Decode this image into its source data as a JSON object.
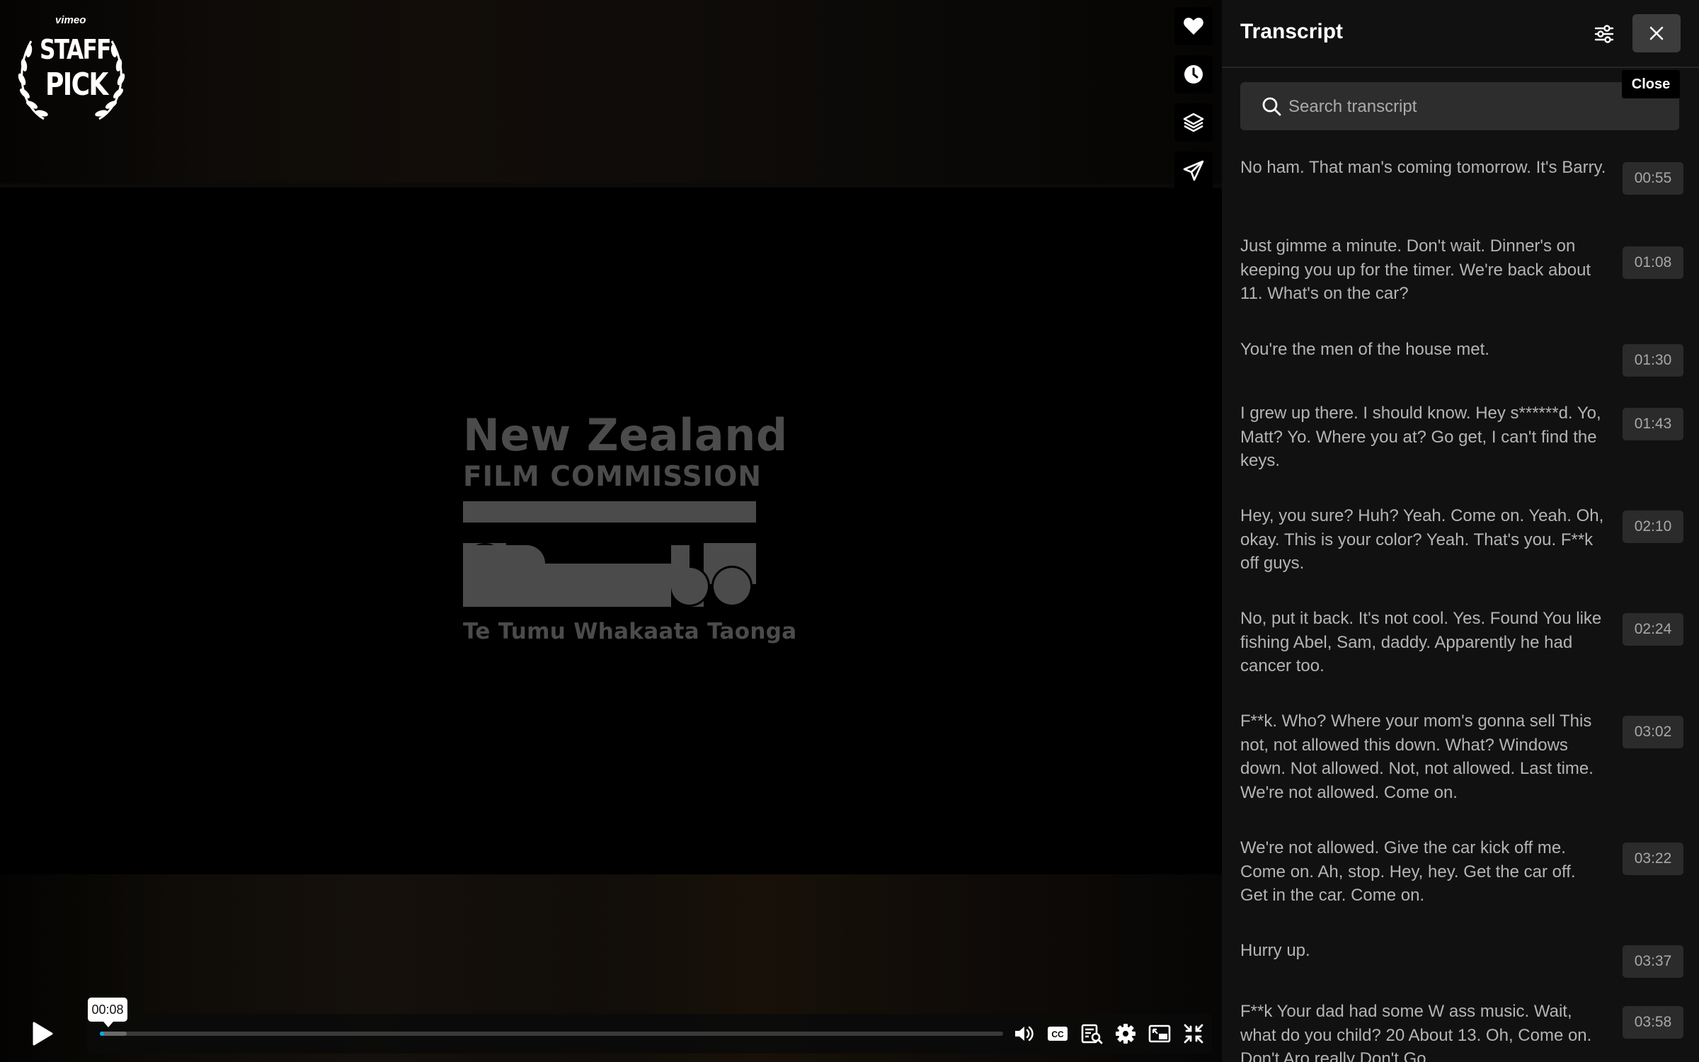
{
  "badge": {
    "brand": "vimeo",
    "line1": "STAFF",
    "line2": "PICK"
  },
  "side_actions": [
    {
      "name": "like-button",
      "icon": "heart-icon"
    },
    {
      "name": "watch-later-button",
      "icon": "clock-icon"
    },
    {
      "name": "collections-button",
      "icon": "layers-icon"
    },
    {
      "name": "share-button",
      "icon": "send-icon"
    }
  ],
  "video_logo": {
    "line1": "New Zealand",
    "line2": "FILM COMMISSION",
    "line3": "Te Tumu Whakaata Taonga"
  },
  "controls": {
    "time_tooltip": "00:08",
    "progress_played": 0.003,
    "progress_loaded": 0.03,
    "accent_color": "#00adef",
    "icons": [
      "volume-icon",
      "captions-icon",
      "transcript-icon",
      "settings-icon",
      "picture-in-picture-icon",
      "exit-fullscreen-icon"
    ]
  },
  "transcript": {
    "title": "Transcript",
    "search_placeholder": "Search transcript",
    "close_tooltip": "Close",
    "items": [
      {
        "text": "No ham. That man's coming tomorrow. It's Barry.",
        "time": "00:55"
      },
      {
        "text": "Just gimme a minute. Don't wait. Dinner's on keeping you up for the timer. We're back about 11. What's on the car?",
        "time": "01:08"
      },
      {
        "text": "You're the men of the house met.",
        "time": "01:30"
      },
      {
        "text": "I grew up there. I should know. Hey s******d. Yo, Matt? Yo. Where you at? Go get, I can't find the keys.",
        "time": "01:43"
      },
      {
        "text": "Hey, you sure? Huh? Yeah. Come on. Yeah. Oh, okay. This is your color? Yeah. That's you. F**k off guys.",
        "time": "02:10"
      },
      {
        "text": "No, put it back. It's not cool. Yes. Found You like fishing Abel, Sam, daddy. Apparently he had cancer too.",
        "time": "02:24"
      },
      {
        "text": "F**k. Who? Where your mom's gonna sell This not, not allowed this down. What? Windows down. Not allowed. Not, not allowed. Last time. We're not allowed. Come on.",
        "time": "03:02"
      },
      {
        "text": "We're not allowed. Give the car kick off me. Come on. Ah, stop. Hey, hey. Get the car off. Get in the car. Come on.",
        "time": "03:22"
      },
      {
        "text": "Hurry up.",
        "time": "03:37"
      },
      {
        "text": "F**k Your dad had some W ass music. Wait, what do you child? 20 About 13. Oh, Come on. Don't Aro really Don't Go",
        "time": "03:58"
      }
    ]
  }
}
